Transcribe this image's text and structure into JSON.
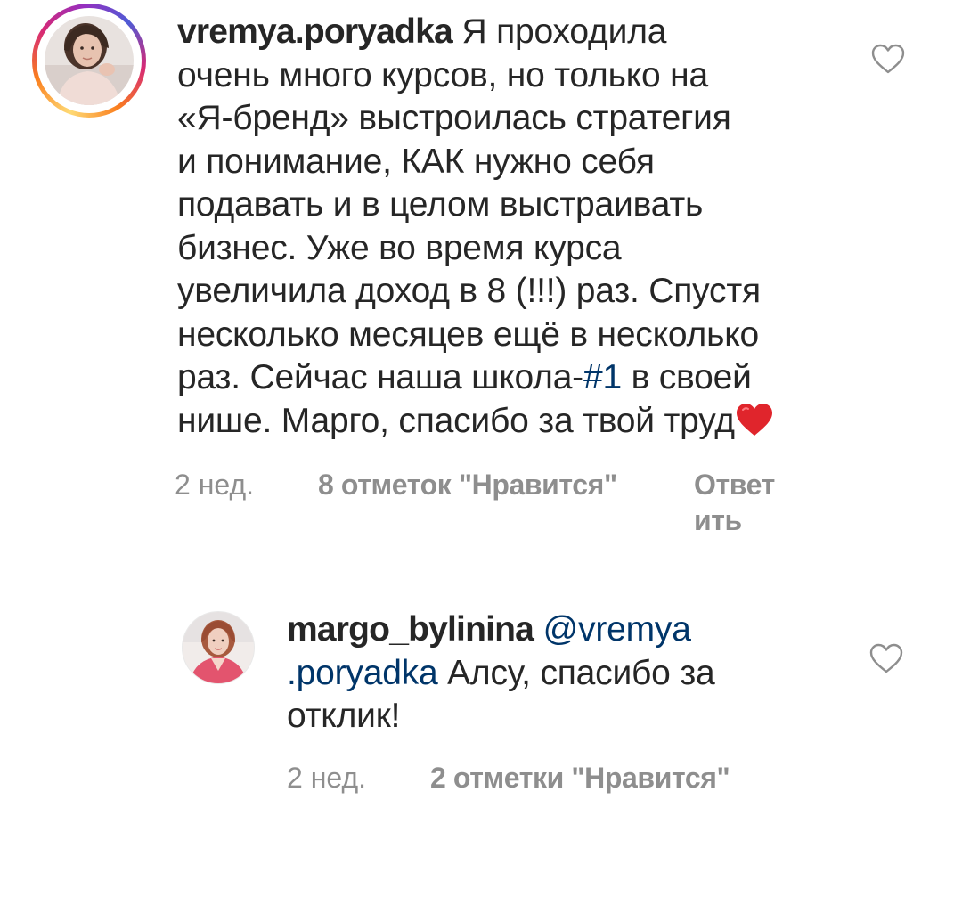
{
  "comments": [
    {
      "username": "vremya.poryadka",
      "text_lines": [
        " Я проходила",
        "очень много курсов, но только на",
        "«Я-бренд» выстроилась стратегия",
        "и понимание, КАК нужно себя",
        "подавать и в целом выстраивать",
        "бизнес. Уже во время курса",
        "увеличила доход в 8 (!!!) раз. Спустя",
        "несколько месяцев ещё в несколько"
      ],
      "line9_before": "раз. Сейчас наша школа-",
      "hashtag": "#1",
      "line9_after": " в своей",
      "line10": "нише. Марго, спасибо за твой труд",
      "emoji": "red-heart",
      "time": "2 нед.",
      "likes": "8 отметок \"Нравится\"",
      "reply": "Ответить",
      "avatar": "woman-portrait"
    },
    {
      "username": "margo_bylinina",
      "mention_part1": " @vremya",
      "mention_part2": ".poryadka",
      "text_after_mention": " Алсу, спасибо за",
      "text_line3": "отклик!",
      "time": "2 нед.",
      "likes": "2 отметки \"Нравится\"",
      "avatar": "woman-portrait-red-hair"
    }
  ],
  "icons": {
    "like": "heart-outline-icon",
    "emoji": "red-heart"
  },
  "colors": {
    "text": "#262626",
    "meta": "#8e8e8e",
    "link": "#003569",
    "emoji_heart": "#e0252c"
  }
}
